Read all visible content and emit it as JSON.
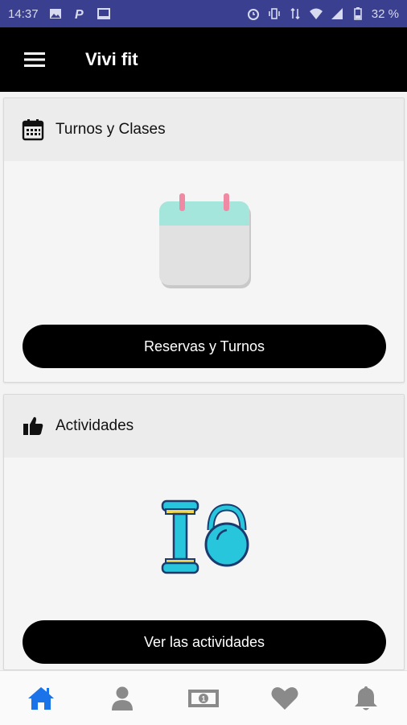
{
  "status_bar": {
    "time": "14:37",
    "battery": "32 %"
  },
  "app_bar": {
    "title": "Vivi fit"
  },
  "cards": [
    {
      "title": "Turnos y Clases",
      "button_label": "Reservas y Turnos"
    },
    {
      "title": "Actividades",
      "button_label": "Ver las actividades"
    }
  ],
  "bottom_nav": {
    "items": [
      "home-icon",
      "profile-icon",
      "money-icon",
      "heart-icon",
      "bell-icon"
    ],
    "active_color": "#1a73e8",
    "inactive_color": "#8a8a8a"
  },
  "colors": {
    "app_bar": "#000000",
    "status_bar": "#3a3f8f",
    "button": "#000000"
  }
}
